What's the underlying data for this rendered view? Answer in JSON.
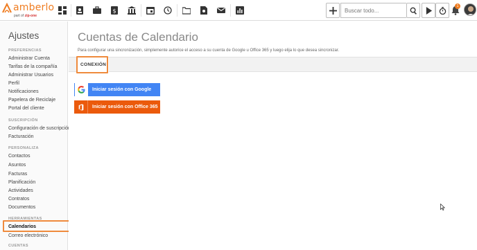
{
  "brand": {
    "name": "amberlo",
    "sub_prefix": "part of",
    "sub_company": "zip-one",
    "color": "#ef7d22"
  },
  "topbar": {
    "search_placeholder": "Buscar todo...",
    "notification_count": "1",
    "icons": [
      "dashboard-icon",
      "contacts-icon",
      "briefcase-icon",
      "invoice-icon",
      "bank-icon",
      "calendar-icon",
      "history-icon",
      "folder-icon",
      "document-search-icon",
      "mail-icon",
      "reports-icon"
    ]
  },
  "sidebar": {
    "title": "Ajustes",
    "sections": [
      {
        "label": "PREFERENCIAS",
        "items": [
          "Administrar Cuenta",
          "Tarifas de la compañía",
          "Administrar Usuarios",
          "Perfil",
          "Notificaciones",
          "Papelera de Reciclaje",
          "Portal del cliente"
        ]
      },
      {
        "label": "SUSCRIPCIÓN",
        "items": [
          "Configuración de suscripción",
          "Facturación"
        ]
      },
      {
        "label": "PERSONALIZA",
        "items": [
          "Contactos",
          "Asuntos",
          "Facturas",
          "Planificación",
          "Actividades",
          "Contratos",
          "Documentos"
        ]
      },
      {
        "label": "HERRAMIENTAS",
        "items": [
          "Calendarios",
          "Correo electrónico"
        ]
      },
      {
        "label": "CUENTAS",
        "items": []
      }
    ],
    "active_item": "Calendarios"
  },
  "main": {
    "title": "Cuentas de Calendario",
    "description": "Para configurar una sincronización, simplemente autorice el acceso a su cuenta de Google u Office 365 y luego elija lo que desea sincronizar.",
    "tab": "CONEXIÓN",
    "google_button": "Iniciar sesión con Google",
    "office_button": "Iniciar sesión con Office 365",
    "highlight_color": "#ef8a3c",
    "google_color": "#4285f4",
    "office_color": "#eb5a0c"
  }
}
